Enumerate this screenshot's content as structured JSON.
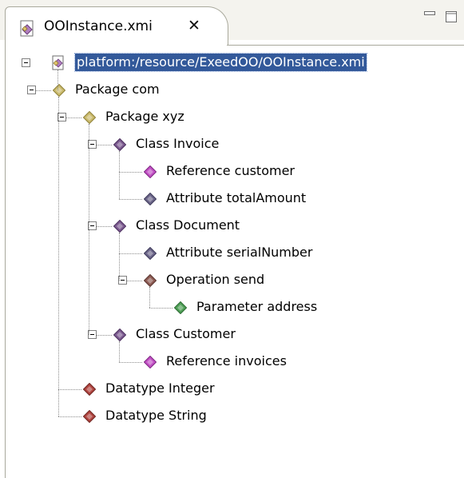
{
  "editor": {
    "tab_title": "OOInstance.xmi",
    "close_glyph": "✕",
    "minimize_glyph": "▭",
    "maximize_glyph": "□"
  },
  "tree": {
    "root": {
      "label": "platform:/resource/ExeedOO/OOInstance.xmi",
      "icon": "xmi-resource-icon",
      "expanded": true,
      "selected": true
    },
    "nodes": [
      {
        "label": "Package com",
        "icon": "package-icon",
        "level": 1,
        "expanded": true
      },
      {
        "label": "Package xyz",
        "icon": "package-icon",
        "level": 2,
        "expanded": true
      },
      {
        "label": "Class Invoice",
        "icon": "class-icon",
        "level": 3,
        "expanded": true
      },
      {
        "label": "Reference customer",
        "icon": "reference-icon",
        "level": 4
      },
      {
        "label": "Attribute totalAmount",
        "icon": "attribute-icon",
        "level": 4
      },
      {
        "label": "Class Document",
        "icon": "class-icon",
        "level": 3,
        "expanded": true
      },
      {
        "label": "Attribute serialNumber",
        "icon": "attribute-icon",
        "level": 4
      },
      {
        "label": "Operation send",
        "icon": "operation-icon",
        "level": 4,
        "expanded": true
      },
      {
        "label": "Parameter address",
        "icon": "parameter-icon",
        "level": 5
      },
      {
        "label": "Class Customer",
        "icon": "class-icon",
        "level": 3,
        "expanded": true
      },
      {
        "label": "Reference invoices",
        "icon": "reference-icon",
        "level": 4
      },
      {
        "label": "Datatype Integer",
        "icon": "datatype-icon",
        "level": 2
      },
      {
        "label": "Datatype String",
        "icon": "datatype-icon",
        "level": 2
      }
    ]
  },
  "colors": {
    "selection": "#33599a",
    "package": "#c9b96b",
    "class": "#7b5a8f",
    "reference": "#c14fc4",
    "attribute": "#6a6488",
    "operation": "#8c5a52",
    "parameter": "#4f9f56",
    "datatype": "#b0443f"
  }
}
